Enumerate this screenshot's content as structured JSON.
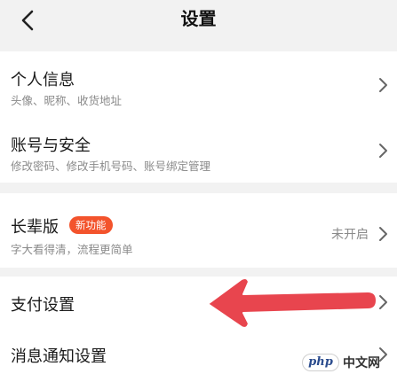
{
  "header": {
    "title": "设置",
    "back_icon": "chevron-left-icon"
  },
  "groups": [
    {
      "items": [
        {
          "title": "个人信息",
          "subtitle": "头像、昵称、收货地址"
        },
        {
          "title": "账号与安全",
          "subtitle": "修改密码、修改手机号码、账号绑定管理"
        }
      ]
    },
    {
      "items": [
        {
          "title": "长辈版",
          "badge": "新功能",
          "subtitle": "字大看得清，流程更简单",
          "status": "未开启"
        }
      ]
    },
    {
      "items": [
        {
          "title": "支付设置"
        },
        {
          "title": "消息通知设置"
        }
      ]
    }
  ],
  "annotation": {
    "arrow_color": "#e8454e",
    "arrow_points_to": "支付设置"
  },
  "watermark": {
    "logo": "php",
    "text": "中文网"
  },
  "colors": {
    "background": "#f2f2f2",
    "card": "#ffffff",
    "badge": "#f3532c",
    "arrow": "#e8454e"
  }
}
